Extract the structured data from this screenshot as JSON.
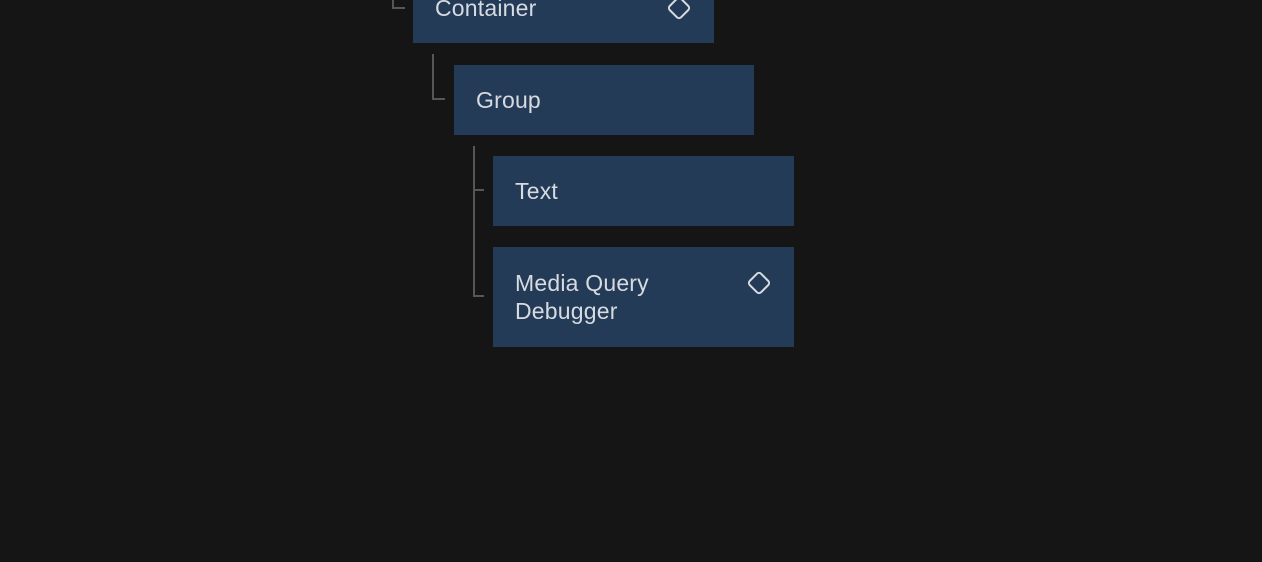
{
  "colors": {
    "background": "#151515",
    "node_background": "#233b56",
    "node_text": "#d7dbe1",
    "connector": "#565656",
    "icon_stroke": "#d7dbe1"
  },
  "tree": {
    "nodes": [
      {
        "label": "Container",
        "icon": "diamond-icon",
        "level": 0,
        "clipped_top": true
      },
      {
        "label": "Group",
        "icon": null,
        "level": 1,
        "clipped_top": false
      },
      {
        "label": "Text",
        "icon": null,
        "level": 2,
        "clipped_top": false
      },
      {
        "label": "Media Query Debugger",
        "icon": "diamond-icon",
        "level": 2,
        "clipped_top": false
      }
    ]
  }
}
